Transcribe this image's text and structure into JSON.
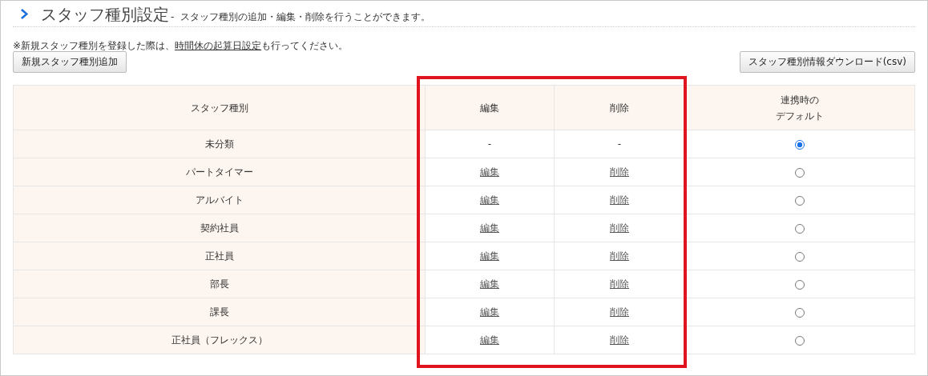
{
  "page_header": {
    "title": "スタッフ種別設定",
    "separator": "-",
    "description": "スタッフ種別の追加・編集・削除を行うことができます。"
  },
  "notice": {
    "before": "※新規スタッフ種別を登録した際は、",
    "link": "時間休の起算日設定",
    "after": "も行ってください。"
  },
  "buttons": {
    "add": "新規スタッフ種別追加",
    "download": "スタッフ種別情報ダウンロード(csv)"
  },
  "table": {
    "columns": [
      {
        "lines": [
          "スタッフ種別"
        ]
      },
      {
        "lines": [
          "編集"
        ]
      },
      {
        "lines": [
          "削除"
        ]
      },
      {
        "lines": [
          "連携時の",
          "デフォルト"
        ]
      }
    ],
    "rows": [
      {
        "name": "未分類",
        "edit": {
          "text": "-",
          "kind": "plain"
        },
        "delete": {
          "text": "-",
          "kind": "plain"
        },
        "selected": true
      },
      {
        "name": "パートタイマー",
        "edit": {
          "text": "編集",
          "kind": "link"
        },
        "delete": {
          "text": "削除",
          "kind": "link"
        },
        "selected": false
      },
      {
        "name": "アルバイト",
        "edit": {
          "text": "編集",
          "kind": "link"
        },
        "delete": {
          "text": "削除",
          "kind": "link"
        },
        "selected": false
      },
      {
        "name": "契約社員",
        "edit": {
          "text": "編集",
          "kind": "link"
        },
        "delete": {
          "text": "削除",
          "kind": "link"
        },
        "selected": false
      },
      {
        "name": "正社員",
        "edit": {
          "text": "編集",
          "kind": "link"
        },
        "delete": {
          "text": "削除",
          "kind": "link"
        },
        "selected": false
      },
      {
        "name": "部長",
        "edit": {
          "text": "編集",
          "kind": "link"
        },
        "delete": {
          "text": "削除",
          "kind": "link"
        },
        "selected": false
      },
      {
        "name": "課長",
        "edit": {
          "text": "編集",
          "kind": "link"
        },
        "delete": {
          "text": "削除",
          "kind": "link"
        },
        "selected": false
      },
      {
        "name": "正社員（フレックス）",
        "edit": {
          "text": "編集",
          "kind": "link"
        },
        "delete": {
          "text": "削除",
          "kind": "link"
        },
        "selected": false
      }
    ]
  },
  "annotation": {
    "kind": "highlight"
  }
}
